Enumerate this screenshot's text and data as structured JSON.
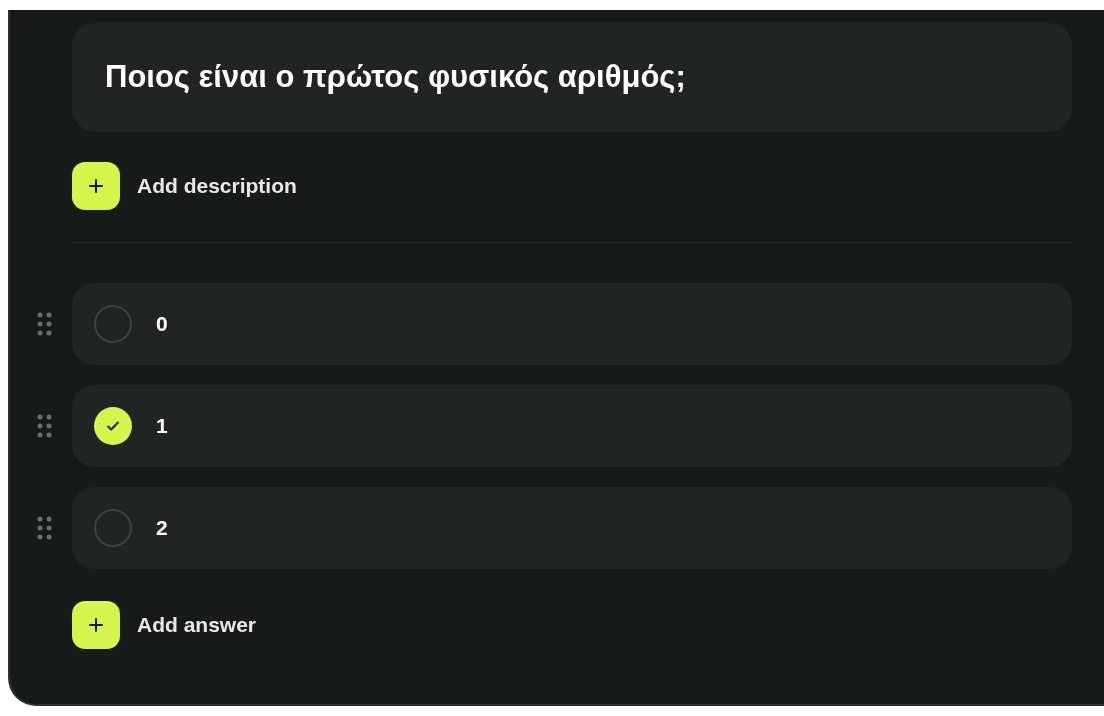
{
  "question": {
    "title": "Ποιος είναι ο πρώτος φυσικός αριθμός;"
  },
  "add_description": {
    "label": "Add description"
  },
  "answers": [
    {
      "text": "0",
      "selected": false
    },
    {
      "text": "1",
      "selected": true
    },
    {
      "text": "2",
      "selected": false
    }
  ],
  "add_answer": {
    "label": "Add answer"
  }
}
